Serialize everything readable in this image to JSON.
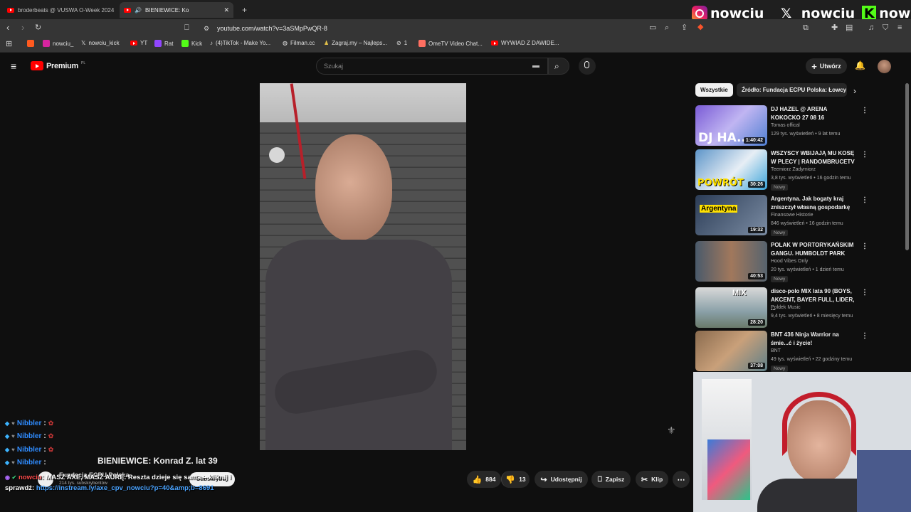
{
  "browser": {
    "tabs": [
      {
        "title": "broderbeats @ VUSWA O-Week 2024"
      },
      {
        "title": "BIENIEWICE: Ko"
      }
    ],
    "new_tab_label": "+",
    "url": "youtube.com/watch?v=3aSMpPwQR-8",
    "bookmarks": [
      "nowciu_",
      "nowciu_kick",
      "YT",
      "Rat",
      "Kick",
      "(4)TikTok - Make Yo...",
      "Filman.cc",
      "Zagraj.my – Najleps...",
      "1",
      "OmeTV Video Chat...",
      "WYWIAD Z DAWIDE..."
    ],
    "accent": "#ff0000"
  },
  "socials": {
    "instagram": "nowciu_",
    "x": "_nowciu",
    "kick": "nowciu"
  },
  "youtube": {
    "logo_text": "Premium",
    "logo_sup": "PL",
    "search_placeholder": "Szukaj",
    "create_label": "Utwórz",
    "chips": [
      "Wszystkie",
      "Źródło: Fundacja ECPU Polska: Łowcy"
    ],
    "recommendations": [
      {
        "title": "DJ HAZEL @ ARENA KOKOCKO 27 08 16",
        "channel": "Tomas offical",
        "meta": "129 tys. wyświetleń • 9 lat temu",
        "duration": "1:40:42",
        "badge": "",
        "thumb_text": "DJ HA..."
      },
      {
        "title": "WSZYSCY WBIJAJĄ MU KOSĘ W PLECY | RANDOMBRUCETV",
        "channel": "Teemiorz Zadymiorz",
        "meta": "3,8 tys. wyświetleń • 16 godzin temu",
        "duration": "30:26",
        "badge": "Nowy",
        "thumb_text": "POWRÓT"
      },
      {
        "title": "Argentyna. Jak bogaty kraj zniszczył własną gospodarkę",
        "channel": "Finansowe Historie",
        "meta": "846 wyświetleń • 16 godzin temu",
        "duration": "19:32",
        "badge": "Nowy",
        "thumb_text": "Argentyna"
      },
      {
        "title": "POLAK W PORTORYKAŃSKIM GANGU. HUMBOLDT PARK",
        "channel": "Hood Vibes Only",
        "meta": "20 tys. wyświetleń • 1 dzień temu",
        "duration": "40:53",
        "badge": "Nowy",
        "thumb_text": ""
      },
      {
        "title": "disco-polo MIX lata 90 (BOYS, AKCENT, BAYER FULL, LIDER, ...",
        "channel": "Poldek Music",
        "meta": "9,4 tys. wyświetleń • 8 miesięcy temu",
        "duration": "28:20",
        "badge": "",
        "thumb_text": "MIX"
      },
      {
        "title": "BNT 436 Ninja Warrior na śmie...ć i życie!",
        "channel": "BNT",
        "meta": "49 tys. wyświetleń • 22 godziny temu",
        "duration": "37:08",
        "badge": "Nowy",
        "thumb_text": ""
      }
    ],
    "video_title": "BIENIEWICE: Konrad Z. lat 39",
    "channel_name": "Fundacja ECPU Polska",
    "subscribers": "214 tys. subskrybentów",
    "subscribe_label": "Subskrybuj",
    "likes": "884",
    "dislikes": "13",
    "share_label": "Udostępnij",
    "save_label": "Zapisz",
    "clip_label": "Klip"
  },
  "chat": {
    "lines": [
      {
        "user": "Nibbler",
        "text": ":"
      },
      {
        "user": "Nibbler",
        "text": ":"
      },
      {
        "user": "Nibbler",
        "text": ":"
      },
      {
        "user": "Nibbler",
        "text": ":"
      }
    ],
    "alert_text": ": MASZ AXE, MASZ AURĘ. Reszta dzieje się sama – kliknij i",
    "alert_line2": "sprawdź: ",
    "alert_link": "https://instream.ly/axe_cpv_nowciu?p=40&amp;b=8691",
    "alert_user": "nowciu"
  }
}
